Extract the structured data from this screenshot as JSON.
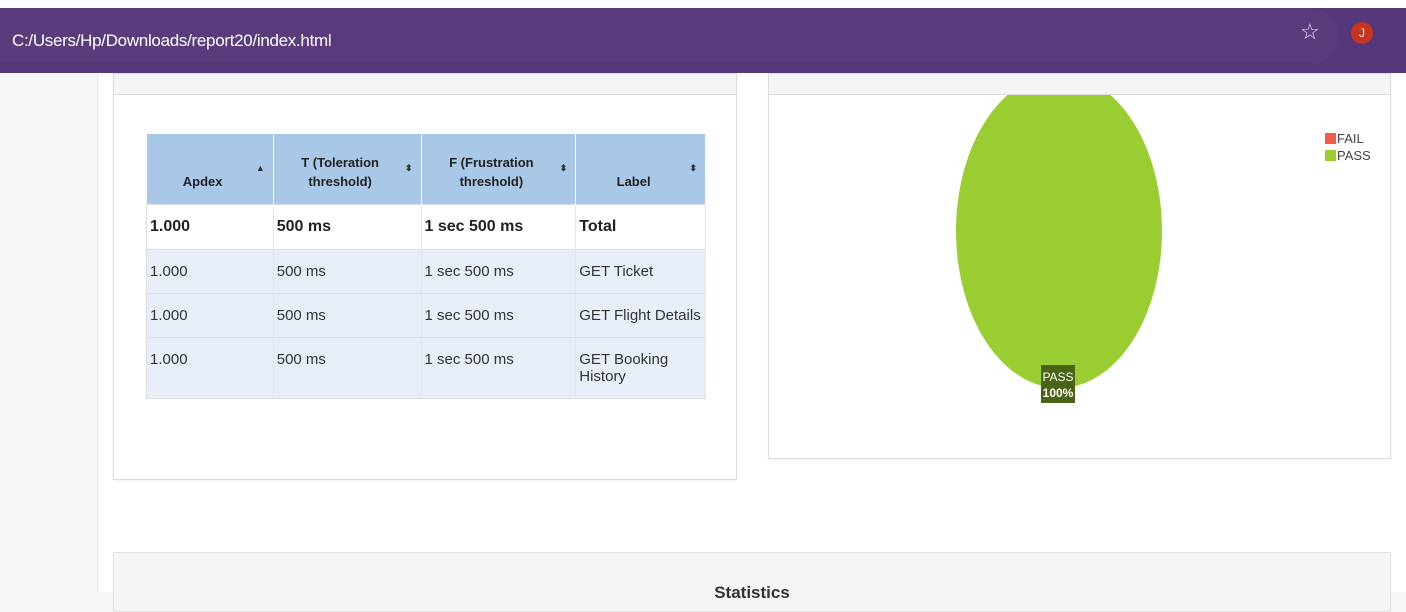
{
  "browser": {
    "url": "C:/Users/Hp/Downloads/report20/index.html",
    "star_glyph": "☆",
    "avatar_letter": "J",
    "avatar_color": "#c8341f"
  },
  "apdex_panel": {
    "columns": [
      {
        "label": "Apdex",
        "sort_glyph": "▲"
      },
      {
        "label": "T (Toleration threshold)",
        "sort_glyph": "⬍"
      },
      {
        "label": "F (Frustration threshold)",
        "sort_glyph": "⬍"
      },
      {
        "label": "Label",
        "sort_glyph": "⬍"
      }
    ],
    "total_row": {
      "apdex": "1.000",
      "toleration": "500 ms",
      "frustration": "1 sec 500 ms",
      "label": "Total"
    },
    "rows": [
      {
        "apdex": "1.000",
        "toleration": "500 ms",
        "frustration": "1 sec 500 ms",
        "label": "GET Ticket"
      },
      {
        "apdex": "1.000",
        "toleration": "500 ms",
        "frustration": "1 sec 500 ms",
        "label": "GET Flight Details"
      },
      {
        "apdex": "1.000",
        "toleration": "500 ms",
        "frustration": "1 sec 500 ms",
        "label": "GET Booking History"
      }
    ],
    "header_color": "#a9c7e6",
    "row_color": "#e8eef7"
  },
  "pie_panel": {
    "legend": [
      {
        "name": "FAIL",
        "color": "#f15b4a"
      },
      {
        "name": "PASS",
        "color": "#9acd32"
      }
    ],
    "slice_label": {
      "name": "PASS",
      "percent": "100%"
    }
  },
  "chart_data": {
    "type": "pie",
    "categories": [
      "FAIL",
      "PASS"
    ],
    "values": [
      0,
      100
    ],
    "colors": [
      "#f15b4a",
      "#9acd32"
    ],
    "legend_position": "top-right"
  },
  "stats_panel": {
    "title": "Statistics"
  }
}
